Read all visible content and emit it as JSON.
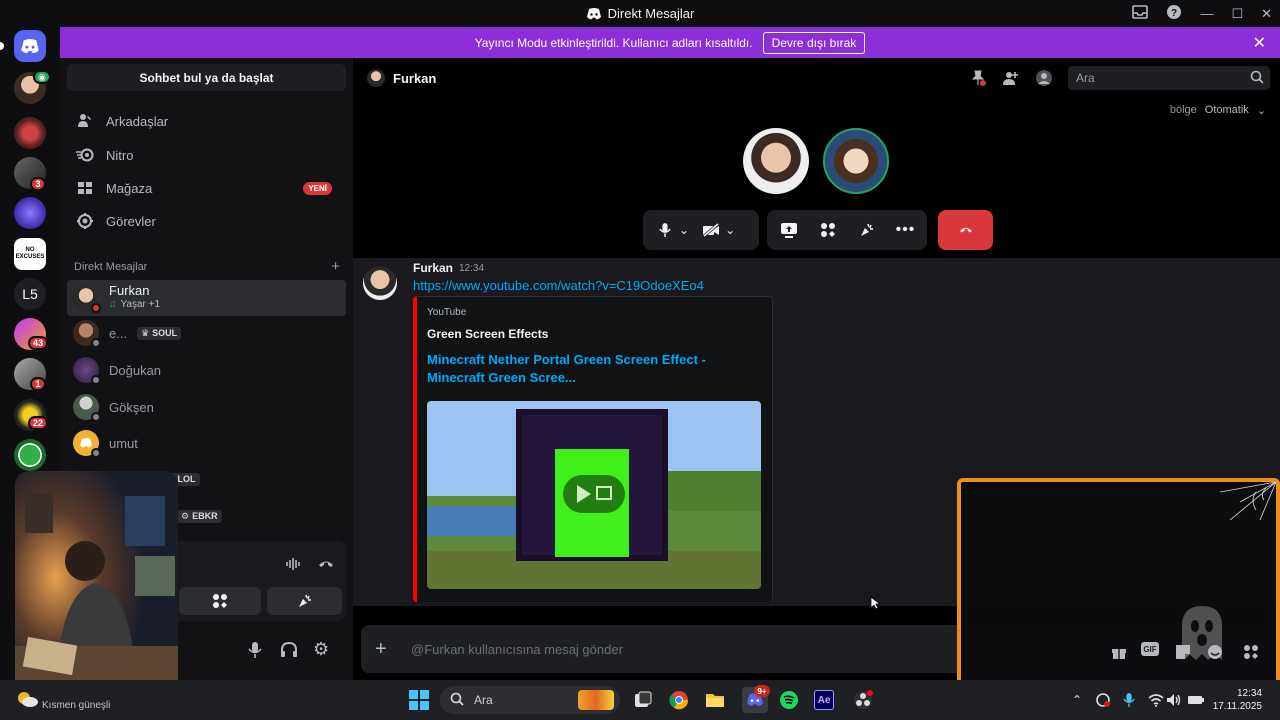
{
  "window": {
    "title": "Direkt Mesajlar"
  },
  "banner": {
    "text": "Yayıncı Modu etkinleştirildi. Kullanıcı adları kısaltıldı.",
    "button": "Devre dışı bırak"
  },
  "rail": {
    "badges": [
      "3",
      "43",
      "1",
      "22"
    ],
    "l5_label": "L5",
    "noexcuses_label": "NO EXCUSES"
  },
  "sidebar": {
    "search_label": "Sohbet bul ya da başlat",
    "nav": [
      {
        "label": "Arkadaşlar",
        "icon": "friends-icon"
      },
      {
        "label": "Nitro",
        "icon": "nitro-icon"
      },
      {
        "label": "Mağaza",
        "icon": "shop-icon",
        "badge": "YENİ"
      },
      {
        "label": "Görevler",
        "icon": "quests-icon"
      }
    ],
    "dm_header": "Direkt Mesajlar",
    "dms": [
      {
        "name": "Furkan",
        "sub": "Yaşar +1",
        "active": true
      },
      {
        "name": "e...",
        "tag": "SOUL"
      },
      {
        "name": "Doğukan"
      },
      {
        "name": "Gökşen"
      },
      {
        "name": "umut"
      },
      {
        "name": "",
        "tag": "LOL"
      },
      {
        "name": "",
        "tag": "EBKR"
      }
    ]
  },
  "chat": {
    "recipient": "Furkan",
    "search_placeholder": "Ara",
    "region_label": "bölge",
    "region_value": "Otomatik",
    "message": {
      "author": "Furkan",
      "time": "12:34",
      "link": "https://www.youtube.com/watch?v=C19OdoeXEo4",
      "embed": {
        "provider": "YouTube",
        "author": "Green Screen Effects",
        "title": "Minecraft Nether Portal Green Screen Effect - Minecraft Green Scree..."
      }
    },
    "composer_placeholder": "@Furkan kullanıcısına mesaj gönder"
  },
  "taskbar": {
    "weather": "Kısmen güneşli",
    "search_label": "Ara",
    "discord_badge": "9+",
    "time": "12:34",
    "date": "17.11.2025"
  },
  "colors": {
    "banner": "#8d2fd9",
    "hangup": "#da373c",
    "link": "#00a8fc",
    "overlay_border": "#f08c1e",
    "embed_border": "#ff0000"
  }
}
